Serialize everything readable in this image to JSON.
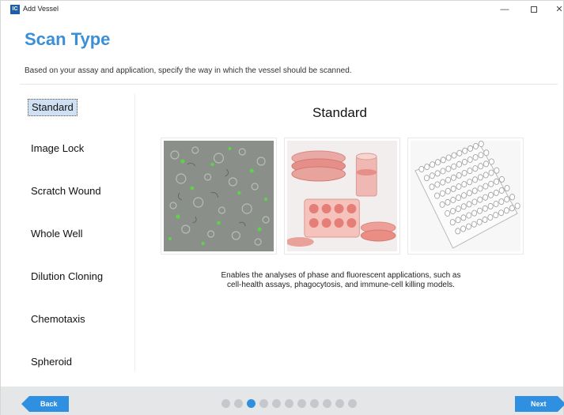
{
  "window": {
    "app_icon_text": "IC",
    "title": "Add Vessel",
    "controls": {
      "minimize": "—",
      "close": "✕"
    }
  },
  "header": {
    "title": "Scan Type",
    "subtitle": "Based on your assay and application, specify the way in which the vessel should be scanned."
  },
  "nav": {
    "items": [
      {
        "label": "Standard",
        "selected": true
      },
      {
        "label": "Image Lock",
        "selected": false
      },
      {
        "label": "Scratch Wound",
        "selected": false
      },
      {
        "label": "Whole Well",
        "selected": false
      },
      {
        "label": "Dilution Cloning",
        "selected": false
      },
      {
        "label": "Chemotaxis",
        "selected": false
      },
      {
        "label": "Spheroid",
        "selected": false
      }
    ]
  },
  "main": {
    "title": "Standard",
    "images": [
      "cell-micrograph",
      "culture-dishes",
      "well-plate"
    ],
    "description_line1": "Enables the analyses of phase and fluorescent applications, such as",
    "description_line2": "cell-health assays, phagocytosis, and immune-cell killing models."
  },
  "footer": {
    "back_label": "Back",
    "next_label": "Next",
    "page_count": 11,
    "current_page": 3
  },
  "colors": {
    "accent": "#2f8fe0",
    "title": "#3b8fd6",
    "selection": "#cfe0f3",
    "footer_bg": "#e4e6e8"
  }
}
